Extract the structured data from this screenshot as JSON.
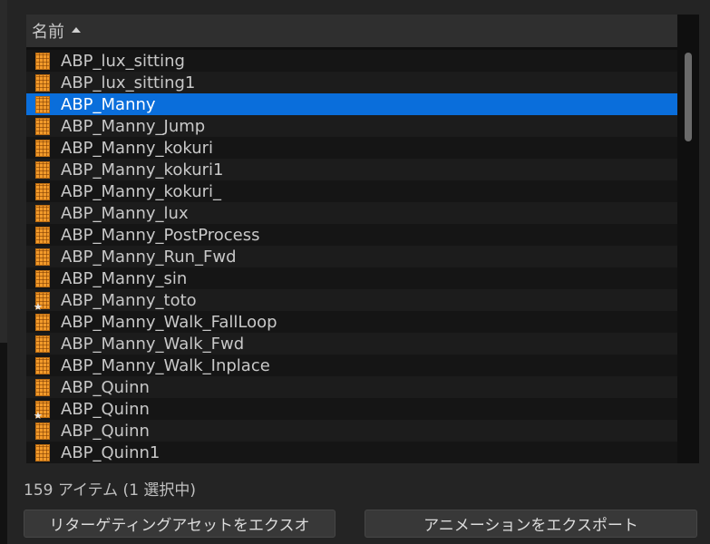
{
  "list": {
    "column_header": "名前",
    "sort_icon": "sort-ascending-icon",
    "selected_index": 2,
    "items": [
      {
        "label": "ABP_lux_sitting",
        "icon": "animation-blueprint-icon",
        "starred": false
      },
      {
        "label": "ABP_lux_sitting1",
        "icon": "animation-blueprint-icon",
        "starred": false
      },
      {
        "label": "ABP_Manny",
        "icon": "animation-blueprint-icon",
        "starred": false
      },
      {
        "label": "ABP_Manny_Jump",
        "icon": "animation-blueprint-icon",
        "starred": false
      },
      {
        "label": "ABP_Manny_kokuri",
        "icon": "animation-blueprint-icon",
        "starred": false
      },
      {
        "label": "ABP_Manny_kokuri1",
        "icon": "animation-blueprint-icon",
        "starred": false
      },
      {
        "label": "ABP_Manny_kokuri_",
        "icon": "animation-blueprint-icon",
        "starred": false
      },
      {
        "label": "ABP_Manny_lux",
        "icon": "animation-blueprint-icon",
        "starred": false
      },
      {
        "label": "ABP_Manny_PostProcess",
        "icon": "animation-blueprint-icon",
        "starred": false
      },
      {
        "label": "ABP_Manny_Run_Fwd",
        "icon": "animation-blueprint-icon",
        "starred": false
      },
      {
        "label": "ABP_Manny_sin",
        "icon": "animation-blueprint-icon",
        "starred": false
      },
      {
        "label": "ABP_Manny_toto",
        "icon": "animation-blueprint-icon",
        "starred": true
      },
      {
        "label": "ABP_Manny_Walk_FallLoop",
        "icon": "animation-blueprint-icon",
        "starred": false
      },
      {
        "label": "ABP_Manny_Walk_Fwd",
        "icon": "animation-blueprint-icon",
        "starred": false
      },
      {
        "label": "ABP_Manny_Walk_Inplace",
        "icon": "animation-blueprint-icon",
        "starred": false
      },
      {
        "label": "ABP_Quinn",
        "icon": "animation-blueprint-icon",
        "starred": false
      },
      {
        "label": "ABP_Quinn",
        "icon": "animation-blueprint-icon",
        "starred": true
      },
      {
        "label": "ABP_Quinn",
        "icon": "animation-blueprint-icon",
        "starred": false
      },
      {
        "label": "ABP_Quinn1",
        "icon": "animation-blueprint-icon",
        "starred": false
      }
    ]
  },
  "status": {
    "text": "159 アイテム (1 選択中)"
  },
  "buttons": {
    "retarget_label": "リターゲティングアセットをエクスオ",
    "export_label": "アニメーションをエクスポート"
  },
  "colors": {
    "selection": "#0a6edb",
    "asset_icon": "#f29a2a"
  }
}
